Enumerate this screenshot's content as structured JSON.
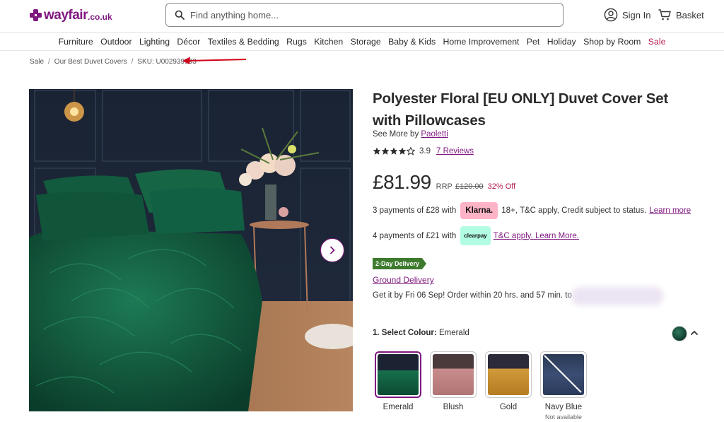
{
  "header": {
    "logo_text": "wayfair",
    "logo_tld": ".co.uk",
    "search_placeholder": "Find anything home...",
    "sign_in": "Sign In",
    "basket": "Basket"
  },
  "nav": [
    {
      "label": "Furniture"
    },
    {
      "label": "Outdoor"
    },
    {
      "label": "Lighting"
    },
    {
      "label": "Décor"
    },
    {
      "label": "Textiles & Bedding"
    },
    {
      "label": "Rugs"
    },
    {
      "label": "Kitchen"
    },
    {
      "label": "Storage"
    },
    {
      "label": "Baby & Kids"
    },
    {
      "label": "Home Improvement"
    },
    {
      "label": "Pet"
    },
    {
      "label": "Holiday"
    },
    {
      "label": "Shop by Room"
    },
    {
      "label": "Sale"
    }
  ],
  "breadcrumb": {
    "items": [
      "Sale",
      "Our Best Duvet Covers"
    ],
    "sku": "SKU: U002939993"
  },
  "product": {
    "title": "Polyester Floral [EU ONLY] Duvet Cover Set with Pillowcases",
    "see_more_prefix": "See More by",
    "brand": "Paoletti",
    "rating": "3.9",
    "reviews": "7 Reviews",
    "price": "£81.99",
    "rrp_label": "RRP",
    "rrp_value": "£120.00",
    "discount": "32% Off",
    "klarna_text": "3 payments of £28 with",
    "klarna_logo": "Klarna.",
    "klarna_terms": "18+, T&C apply, Credit subject to status.",
    "klarna_link": "Learn more",
    "clearpay_text": "4 payments of £21 with",
    "clearpay_logo": "clearpay",
    "clearpay_link": "T&C apply. Learn More.",
    "delivery_badge": "2-Day Delivery",
    "ground_delivery": "Ground Delivery",
    "get_it": "Get it by Fri 06 Sep! Order within 20 hrs. and 57 min. to",
    "colour_label": "1. Select Colour:",
    "colour_value": "Emerald"
  },
  "swatches": [
    {
      "label": "Emerald",
      "sub": ""
    },
    {
      "label": "Blush",
      "sub": ""
    },
    {
      "label": "Gold",
      "sub": ""
    },
    {
      "label": "Navy Blue",
      "sub": "Not available"
    }
  ],
  "colors": {
    "brand": "#7f187f",
    "sale": "#b5174d",
    "delivery_green": "#3d7a2e",
    "klarna_pink": "#ffb3c7",
    "clearpay_mint": "#b2fce4"
  },
  "icons": {
    "search": "search-icon",
    "account": "user-icon",
    "basket": "cart-icon",
    "next": "chevron-right-icon",
    "collapse": "chevron-up-icon"
  }
}
